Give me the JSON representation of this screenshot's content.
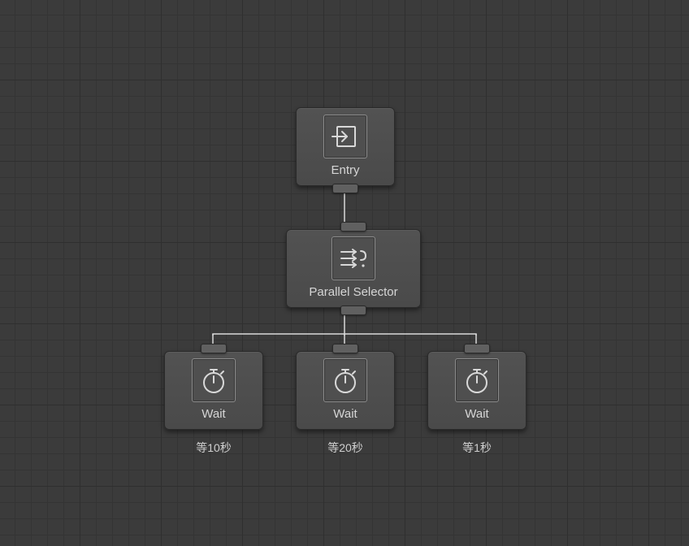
{
  "nodes": {
    "entry": {
      "label": "Entry"
    },
    "selector": {
      "label": "Parallel Selector"
    },
    "wait1": {
      "label": "Wait",
      "sub": "等10秒"
    },
    "wait2": {
      "label": "Wait",
      "sub": "等20秒"
    },
    "wait3": {
      "label": "Wait",
      "sub": "等1秒"
    }
  }
}
